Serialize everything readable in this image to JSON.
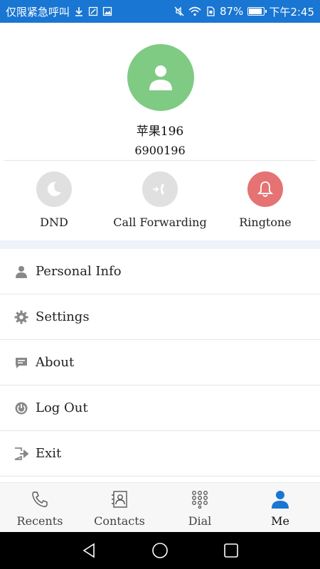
{
  "status_bar": {
    "carrier_text": "仅限紧急呼叫",
    "battery_percent": "87%",
    "battery_level": 0.87,
    "time": "下午2:45"
  },
  "profile": {
    "name": "苹果196",
    "number": "6900196",
    "avatar_color": "#7fcb84"
  },
  "quick_actions": [
    {
      "label": "DND",
      "icon": "moon-icon",
      "color": "#e0e0e0"
    },
    {
      "label": "Call Forwarding",
      "icon": "call-forward-icon",
      "color": "#e0e0e0"
    },
    {
      "label": "Ringtone",
      "icon": "bell-icon",
      "color": "#e57373"
    }
  ],
  "menu": [
    {
      "label": "Personal Info",
      "icon": "person-icon"
    },
    {
      "label": "Settings",
      "icon": "gear-icon"
    },
    {
      "label": "About",
      "icon": "message-icon"
    },
    {
      "label": "Log Out",
      "icon": "power-icon"
    },
    {
      "label": "Exit",
      "icon": "exit-icon"
    }
  ],
  "bottom_nav": {
    "active": "Me",
    "active_color": "#1976d2",
    "items": [
      {
        "label": "Recents",
        "icon": "phone-icon"
      },
      {
        "label": "Contacts",
        "icon": "contacts-icon"
      },
      {
        "label": "Dial",
        "icon": "dialpad-icon"
      },
      {
        "label": "Me",
        "icon": "person-icon"
      }
    ]
  }
}
